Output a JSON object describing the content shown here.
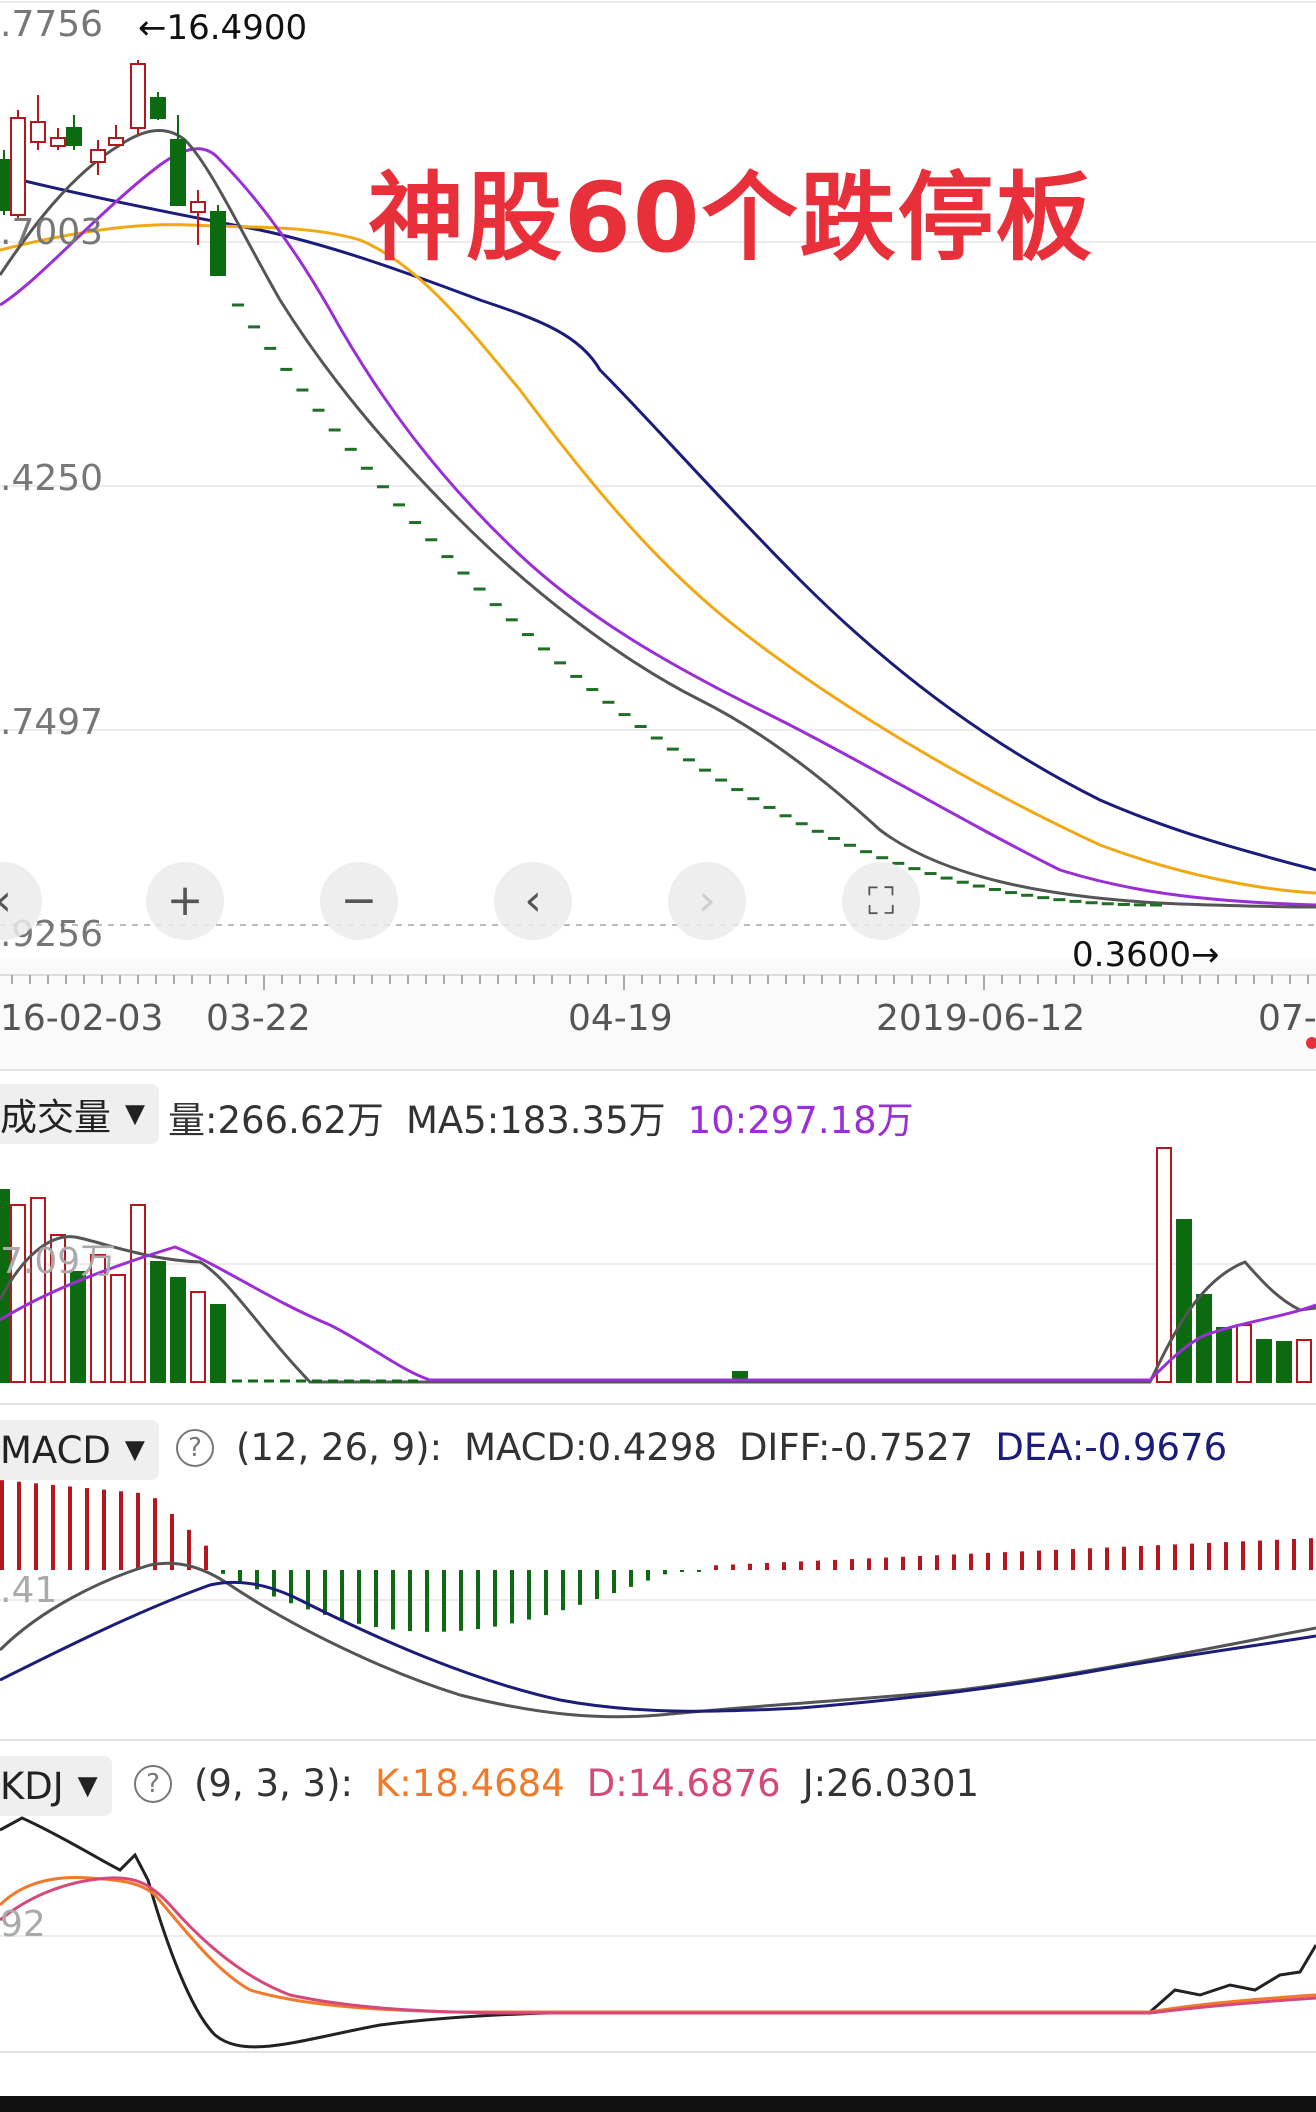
{
  "colors": {
    "up": "#b5171e",
    "down": "#0c6b11",
    "ma_gray": "#555555",
    "ma_purple": "#9b2fd6",
    "ma_orange": "#f0a915",
    "ma_navy": "#1c1c7a",
    "limit_down_dash": "#1e6e26",
    "title_red": "#e8303a",
    "k_line": "#f07a2a",
    "d_line": "#d6477a",
    "j_line": "#222222",
    "dea": "#1c1c7a"
  },
  "main_chart": {
    "y_axis_labels": [
      ".7756",
      ".7003",
      ".4250",
      ".7497",
      ".9256"
    ],
    "high_marker": "←16.4900",
    "low_marker": "0.3600→",
    "overlay_title": "神股60个跌停板",
    "zoom_controls": [
      {
        "name": "scroll-left",
        "icon": "chevron-left-icon",
        "glyph": "‹"
      },
      {
        "name": "zoom-in",
        "icon": "plus-icon",
        "glyph": "+"
      },
      {
        "name": "zoom-out",
        "icon": "minus-icon",
        "glyph": "−"
      },
      {
        "name": "step-back",
        "icon": "chevron-left-icon",
        "glyph": "‹"
      },
      {
        "name": "step-forward",
        "icon": "chevron-right-icon",
        "glyph": "›"
      },
      {
        "name": "fullscreen",
        "icon": "fullscreen-icon",
        "glyph": "⛶"
      }
    ]
  },
  "date_axis": {
    "labels": [
      "16-02-03",
      "03-22",
      "04-19",
      "2019-06-12",
      "07-"
    ]
  },
  "volume_panel": {
    "dropdown_label": "成交量",
    "volume": "量:266.62万",
    "ma5": "MA5:183.35万",
    "ma10": "10:297.18万",
    "axis_label": "7.09万"
  },
  "macd_panel": {
    "dropdown_label": "MACD",
    "params": "(12, 26, 9):",
    "macd": "MACD:0.4298",
    "diff": "DIFF:-0.7527",
    "dea": "DEA:-0.9676",
    "axis_label": ".41"
  },
  "kdj_panel": {
    "dropdown_label": "KDJ",
    "params": "(9, 3, 3):",
    "k": "K:18.4684",
    "d": "D:14.6876",
    "j": "J:26.0301",
    "axis_label": "92"
  }
}
